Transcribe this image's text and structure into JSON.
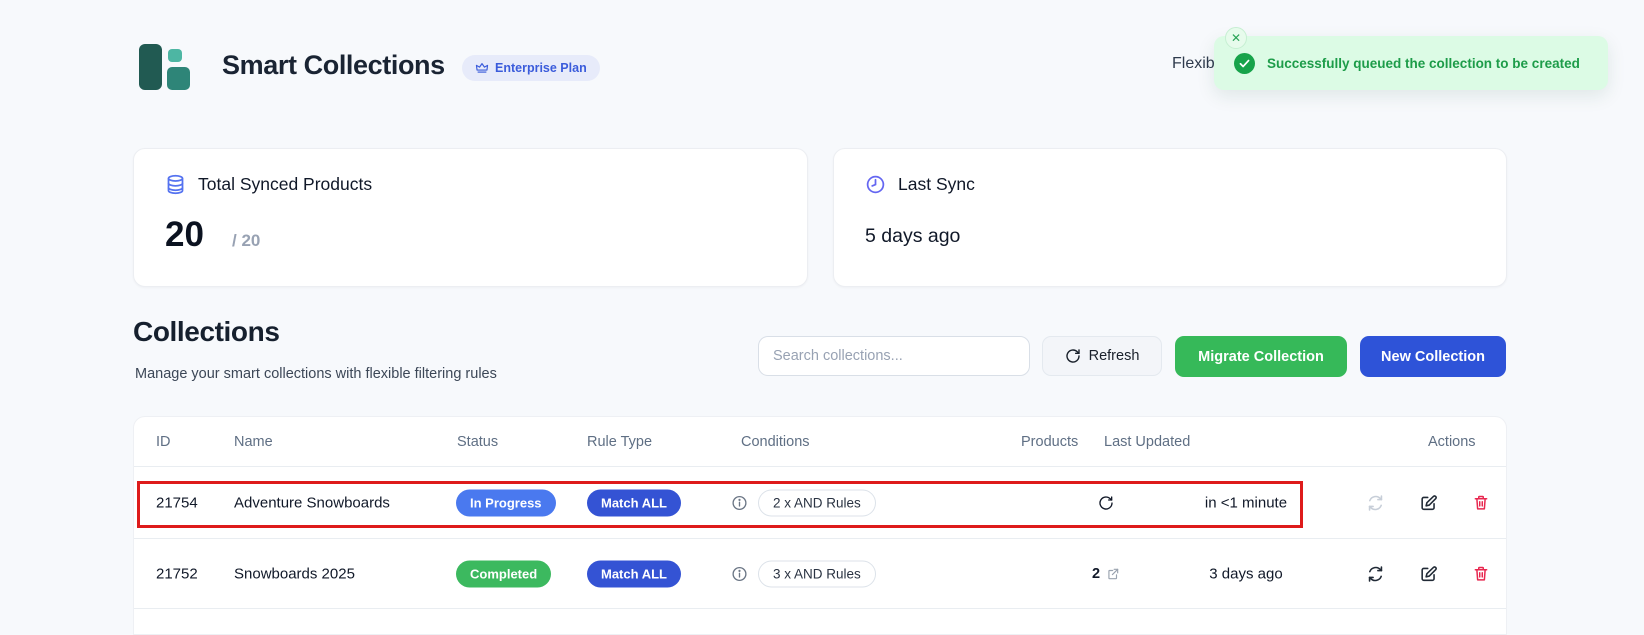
{
  "header": {
    "title": "Smart Collections",
    "plan_badge": "Enterprise Plan",
    "right_text": "Flexib"
  },
  "toast": {
    "message": "Successfully queued the collection to be created",
    "close_label": "✕"
  },
  "stats": {
    "synced": {
      "label": "Total Synced Products",
      "value": "20",
      "total": "/ 20"
    },
    "last_sync": {
      "label": "Last Sync",
      "value": "5 days ago"
    }
  },
  "collections": {
    "heading": "Collections",
    "subheading": "Manage your smart collections with flexible filtering rules",
    "search_placeholder": "Search collections...",
    "refresh_label": "Refresh",
    "migrate_label": "Migrate Collection",
    "new_label": "New Collection"
  },
  "table": {
    "columns": [
      "ID",
      "Name",
      "Status",
      "Rule Type",
      "Conditions",
      "Products",
      "Last Updated",
      "Actions"
    ],
    "rows": [
      {
        "id": "21754",
        "name": "Adventure Snowboards",
        "status": "In Progress",
        "rule_type": "Match ALL",
        "conditions": "2 x AND Rules",
        "products": "",
        "last_updated": "in <1 minute"
      },
      {
        "id": "21752",
        "name": "Snowboards 2025",
        "status": "Completed",
        "rule_type": "Match ALL",
        "conditions": "3 x AND Rules",
        "products": "2",
        "last_updated": "3 days ago"
      }
    ]
  },
  "icons": {
    "logo": "teal-blocks-logo",
    "plan": "crown-icon",
    "stat_products": "database-icon",
    "stat_sync": "clock-icon",
    "refresh_button": "rotate-arrow-icon",
    "toast_status": "check-circle-icon",
    "toast_close": "close-icon",
    "conditions_info": "info-circle-icon",
    "products_pending": "sync-pending-icon",
    "products_link": "external-link-icon",
    "action_sync": "sync-arrows-icon",
    "action_edit": "edit-pencil-icon",
    "action_delete": "trash-icon"
  },
  "colors": {
    "page_bg": "#f7f9fc",
    "accent_blue": "#2e53d8",
    "accent_green": "#36b959",
    "badge_in_progress": "#4a79ef",
    "badge_completed": "#3cb95f",
    "badge_match_all": "#3453d4",
    "toast_bg": "#dcfbe5",
    "toast_text": "#1d9c49",
    "highlight_border": "#de1b1b",
    "plan_badge_bg": "#e7ebfa",
    "plan_badge_text": "#3b5cdb",
    "stat_icon_blue": "#5472f0",
    "stat_icon_indigo": "#6466f1",
    "delete_icon": "#e8274f",
    "logo_teal_dark": "#215a52",
    "logo_teal_mid": "#2e8578",
    "logo_teal_light": "#4db6a3"
  }
}
